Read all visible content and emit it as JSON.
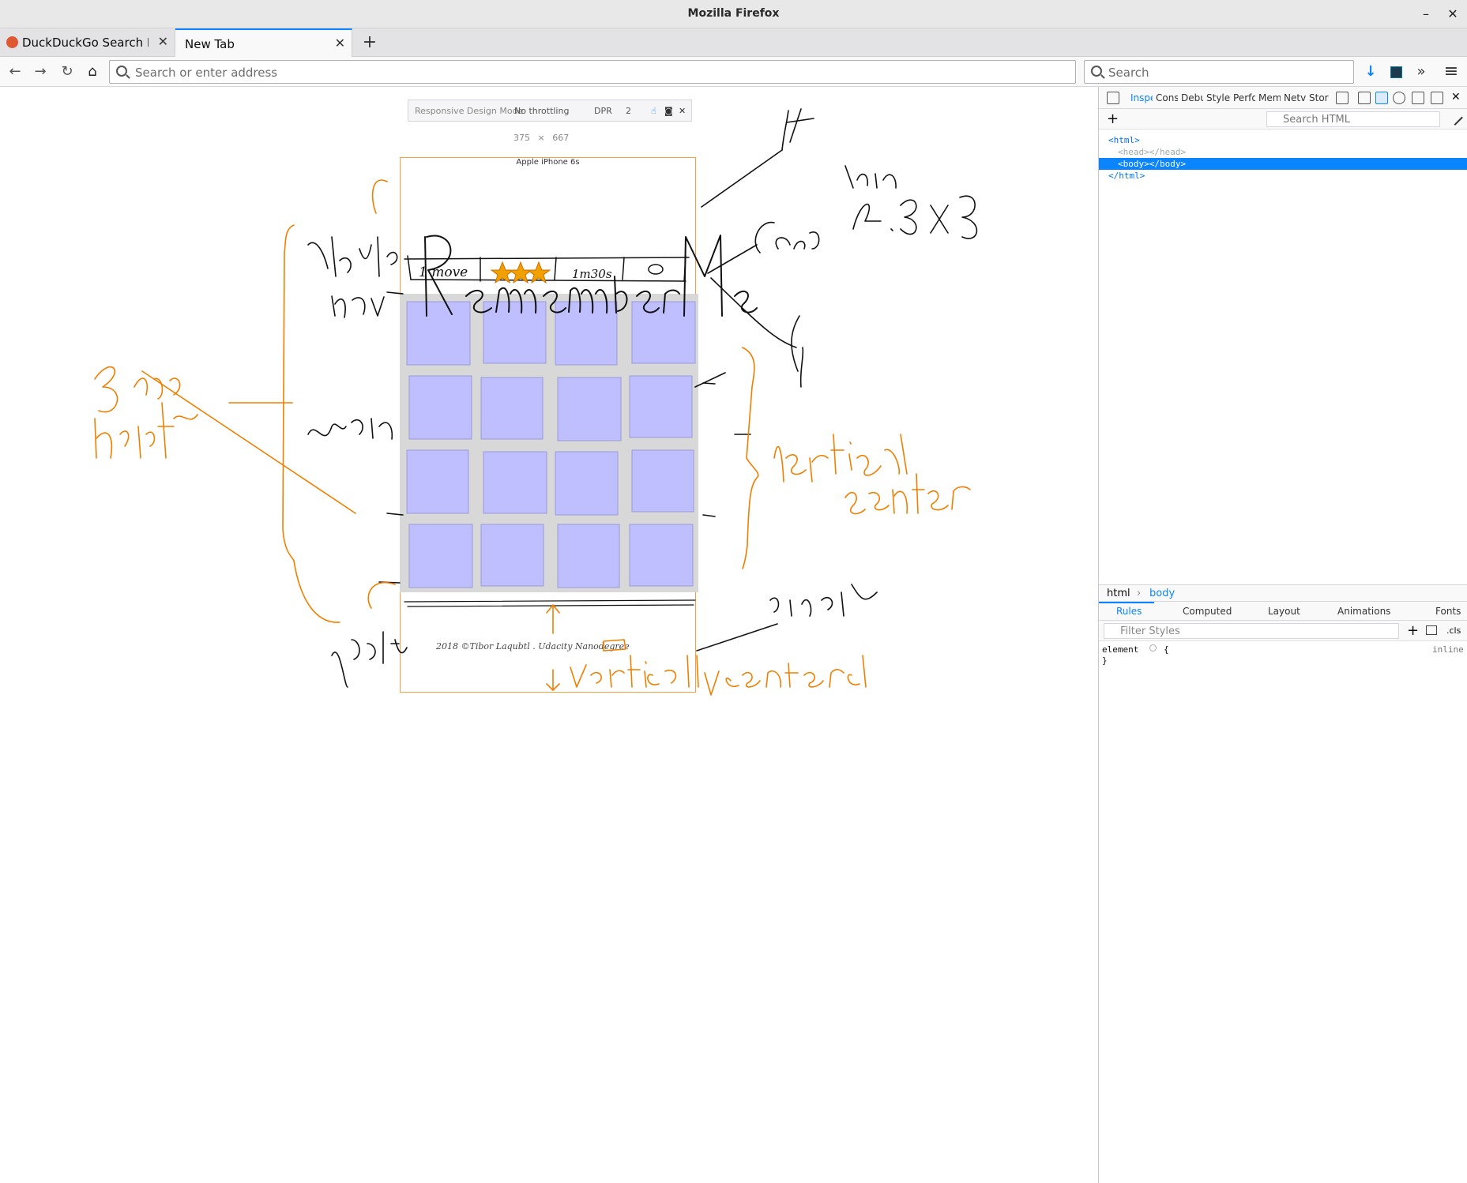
{
  "window": {
    "title": "Mozilla Firefox",
    "minimize_glyph": "–",
    "close_glyph": "✕"
  },
  "tabs": [
    {
      "label": "DuckDuckGo Search Engi",
      "close": "✕",
      "active": false
    },
    {
      "label": "New Tab",
      "close": "✕",
      "active": true
    }
  ],
  "new_tab_glyph": "+",
  "navbar": {
    "back_glyph": "←",
    "forward_glyph": "→",
    "reload_glyph": "↻",
    "home_glyph": "⌂",
    "url_placeholder": "Search or enter address",
    "search_placeholder": "Search",
    "download_glyph": "↓",
    "overflow_glyph": "»",
    "menu_glyph": "≡"
  },
  "rdm": {
    "mode_label": "Responsive Design Mode",
    "throttling": "No throttling",
    "dpr_label": "DPR",
    "dpr_value": "2",
    "touch_glyph": "☝",
    "screenshot_glyph": "◙",
    "close_glyph": "✕",
    "width": "375",
    "times": "×",
    "height": "667",
    "device": "Apple iPhone 6s"
  },
  "devtools": {
    "tabs": [
      "Inspe",
      "Cons",
      "Debu",
      "Style",
      "Perfo",
      "Mem",
      "Netv",
      "Stor"
    ],
    "add_glyph": "+",
    "html_search_placeholder": "Search HTML",
    "markup": [
      {
        "text": "<html>",
        "indent": 1,
        "selected": false,
        "dim": false
      },
      {
        "text": "<head></head>",
        "indent": 2,
        "selected": false,
        "dim": true
      },
      {
        "text": "<body></body>",
        "indent": 2,
        "selected": true,
        "dim": false
      },
      {
        "text": "</html>",
        "indent": 1,
        "selected": false,
        "dim": false
      }
    ],
    "breadcrumbs": [
      "html",
      "body"
    ],
    "breadcrumb_separator": "›",
    "rules_tabs": [
      "Rules",
      "Computed",
      "Layout",
      "Animations",
      "Fonts"
    ],
    "filter_placeholder": "Filter Styles",
    "filter_add_glyph": "+",
    "cls_label": ".cls",
    "rule_selector": "element",
    "rule_open": "{",
    "rule_close": "}",
    "rule_source": "inline"
  },
  "sketch": {
    "card_color": "#bfbfff",
    "gutter_color": "#d8d8d8",
    "ink_color": "#111111",
    "annotation_color": "#f07f00",
    "star_color": "#f0a000",
    "nav_moves": "1 move",
    "nav_time": "1m30s",
    "footer_text": "2018 ©Tibor Laqubtl . Udacity Nanodegree"
  }
}
